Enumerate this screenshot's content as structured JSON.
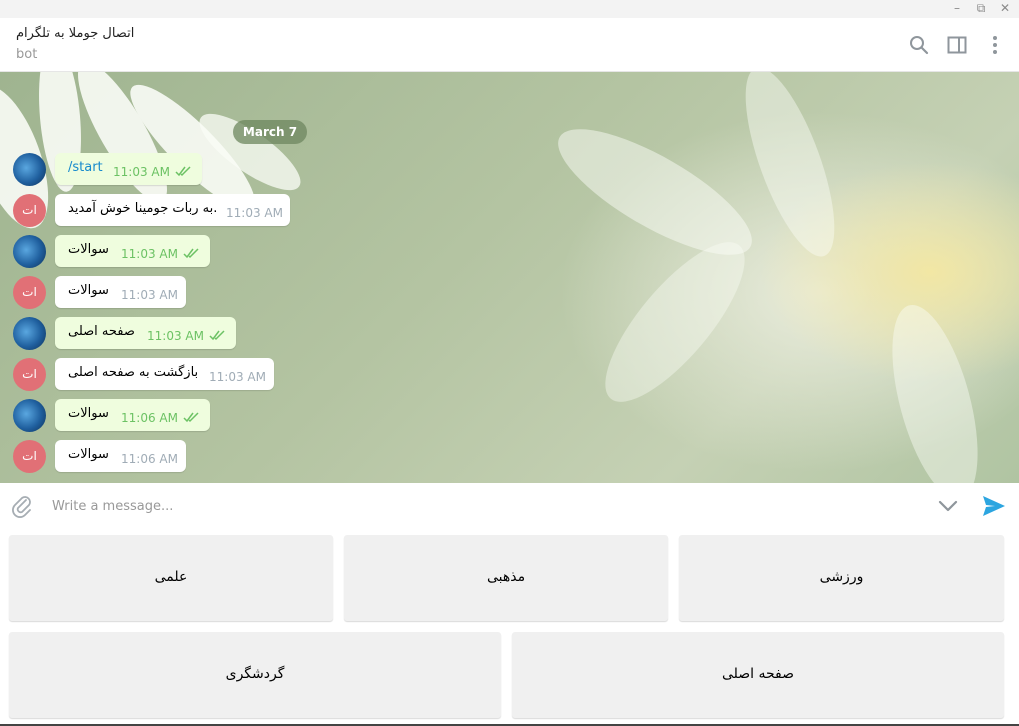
{
  "window": {
    "minimize_glyph": "–",
    "restore_glyph": "⧉",
    "close_glyph": "✕"
  },
  "header": {
    "title": "اتصال جوملا به تلگرام",
    "status": "bot",
    "icons": [
      "search-icon",
      "sidebar-toggle-icon",
      "more-vertical-icon"
    ]
  },
  "chat": {
    "date_label": "March 7",
    "messages": [
      {
        "direction": "out",
        "text": "/start",
        "time": "11:03 AM",
        "read": true
      },
      {
        "direction": "in",
        "avatar": "ات",
        "text": "به ربات جومینا خوش آمدید.",
        "time": "11:03 AM"
      },
      {
        "direction": "out",
        "text": "سوالات",
        "time": "11:03 AM",
        "read": true
      },
      {
        "direction": "in",
        "avatar": "ات",
        "text": "سوالات",
        "time": "11:03 AM"
      },
      {
        "direction": "out",
        "text": "صفحه اصلی",
        "time": "11:03 AM",
        "read": true
      },
      {
        "direction": "in",
        "avatar": "ات",
        "text": "بازگشت به صفحه اصلی",
        "time": "11:03 AM"
      },
      {
        "direction": "out",
        "text": "سوالات",
        "time": "11:06 AM",
        "read": true
      },
      {
        "direction": "in",
        "avatar": "ات",
        "text": "سوالات",
        "time": "11:06 AM"
      }
    ]
  },
  "composer": {
    "placeholder": "Write a message...",
    "icons": [
      "attach-icon",
      "keyboard-toggle-icon",
      "send-icon"
    ]
  },
  "keyboard": {
    "row1": [
      "ورزشی",
      "مذهبی",
      "علمی"
    ],
    "row2": [
      "صفحه اصلی",
      "گردشگری"
    ]
  },
  "colors": {
    "accent": "#168acd",
    "send": "#2ca5e0",
    "outgoing_bubble": "#effdde",
    "read_ticks": "#6cc264",
    "avatar_initials_bg": "#e17076"
  }
}
